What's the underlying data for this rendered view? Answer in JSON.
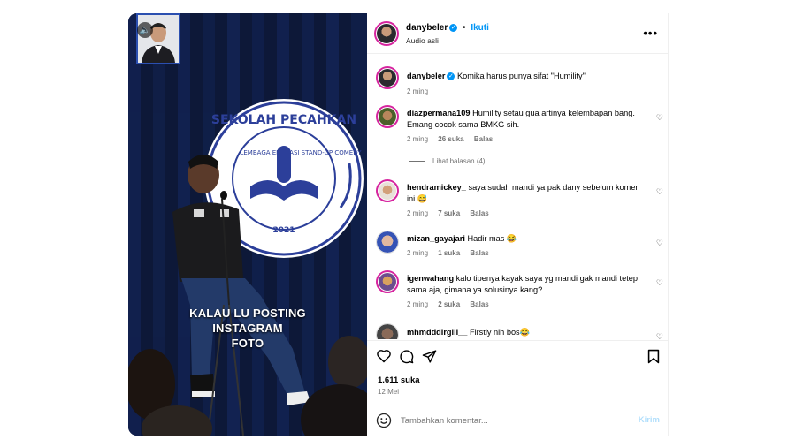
{
  "media": {
    "caption_line1": "KALAU LU POSTING INSTAGRAM",
    "caption_line2": "FOTO",
    "banner_text": "SEKOLAH PECAHKAN",
    "banner_subtext": "LEMBAGA EDUKASI STAND-UP COMEDY",
    "banner_year": "2021"
  },
  "header": {
    "username": "danybeler",
    "follow_label": "Ikuti",
    "separator": "•",
    "audio_label": "Audio asli"
  },
  "post_caption": {
    "username": "danybeler",
    "text": "Komika harus punya sifat \"Humility\"",
    "time": "2 ming"
  },
  "comments": [
    {
      "username": "diazpermana109",
      "text": "Humility setau gua artinya kelembapan bang. Emang cocok sama BMKG sih.",
      "time": "2 ming",
      "likes": "26 suka",
      "reply": "Balas",
      "replies_label": "Lihat balasan (4)"
    },
    {
      "username": "hendramickey_",
      "text": "saya sudah mandi ya pak dany sebelum komen ini 😅",
      "time": "2 ming",
      "likes": "7 suka",
      "reply": "Balas"
    },
    {
      "username": "mizan_gayajari",
      "text": "Hadir mas 😂",
      "time": "2 ming",
      "likes": "1 suka",
      "reply": "Balas"
    },
    {
      "username": "igenwahang",
      "text": "kalo tipenya kayak saya yg mandi gak mandi tetep sama aja, gimana ya solusinya kang?",
      "time": "2 ming",
      "likes": "2 suka",
      "reply": "Balas"
    },
    {
      "username": "mhmdddirgiii__",
      "text": "Firstly nih bos😂",
      "time": "",
      "likes": "",
      "reply": ""
    }
  ],
  "actions": {
    "likes": "1.611 suka",
    "date": "12 Mei"
  },
  "composer": {
    "placeholder": "Tambahkan komentar...",
    "post_label": "Kirim"
  },
  "colors": {
    "accent": "#0095f6",
    "ring": "#d6249f",
    "stage_bg": "#0f1a3c"
  },
  "icons": [
    "mute-icon",
    "more-icon",
    "heart-icon",
    "comment-icon",
    "share-icon",
    "bookmark-icon",
    "emoji-icon",
    "verified-icon"
  ]
}
